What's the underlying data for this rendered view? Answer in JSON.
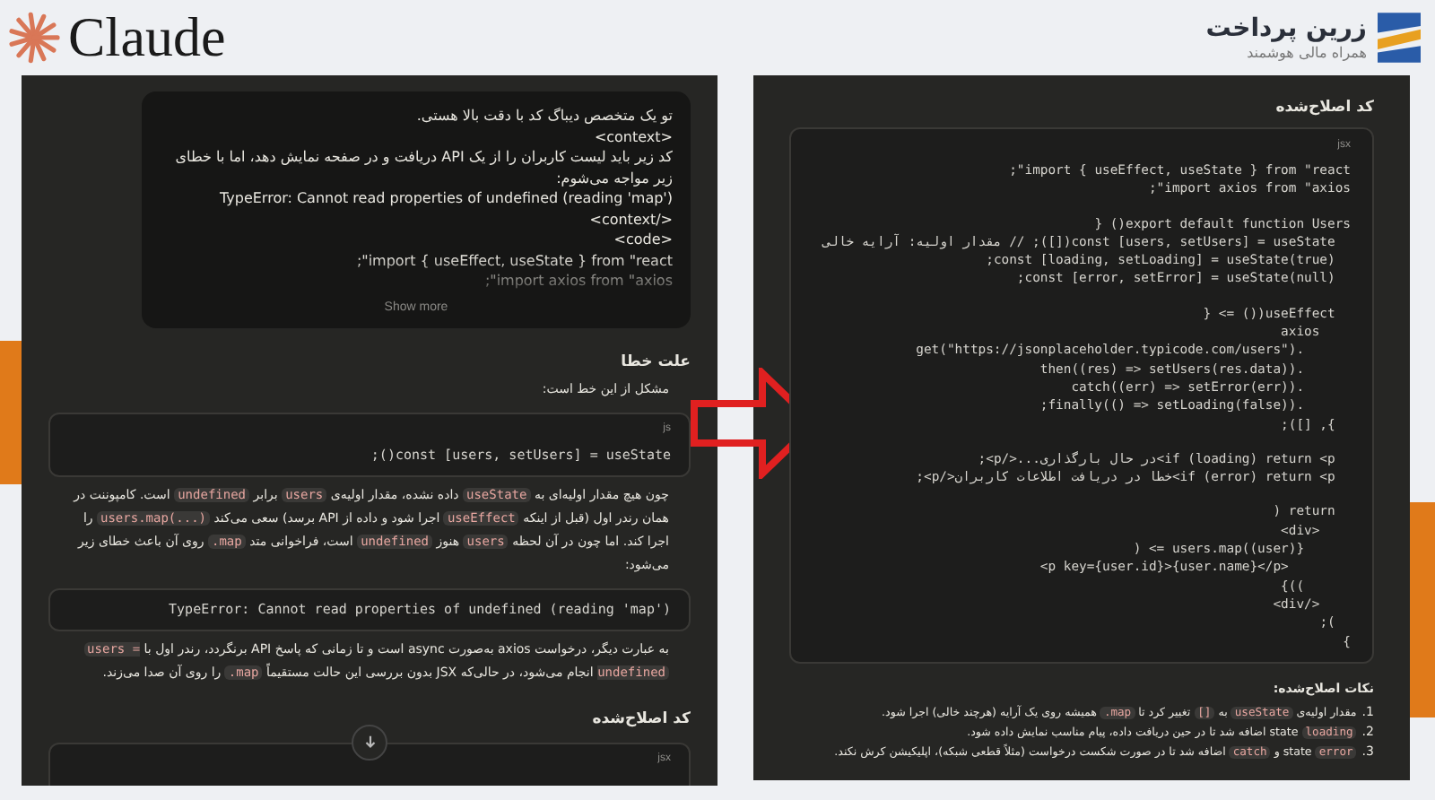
{
  "header": {
    "left_logo": "Claude",
    "right_logo": {
      "name": "زرین پرداخت",
      "tagline": "همراه مالی هوشمند"
    }
  },
  "left_panel": {
    "prompt": {
      "lines": [
        "تو یک متخصص دیباگ کد با دقت بالا هستی.",
        "<context>",
        "کد زیر باید لیست کاربران را از یک API دریافت و در صفحه نمایش دهد، اما با خطای زیر مواجه می‌شوم:",
        "TypeError: Cannot read properties of undefined (reading 'map')",
        "</context>",
        "<code>",
        "import { useEffect, useState } from \"react\";",
        "import axios from \"axios\";"
      ],
      "show_more": "Show more"
    },
    "blocks": [
      {
        "kind": "heading",
        "text": "علت خطا"
      },
      {
        "kind": "paragraph",
        "parts": [
          {
            "kind": "text",
            "text": "مشکل از این خط است:"
          }
        ]
      },
      {
        "kind": "code",
        "language": "js",
        "groups": [
          [
            "const [users, setUsers] = useState();"
          ]
        ]
      },
      {
        "kind": "paragraph",
        "parts": [
          {
            "kind": "text",
            "text": "چون هیچ مقدار اولیه‌ای به "
          },
          {
            "kind": "code",
            "text": "useState"
          },
          {
            "kind": "text",
            "text": " داده نشده، مقدار اولیه‌ی "
          },
          {
            "kind": "code",
            "text": "users"
          },
          {
            "kind": "text",
            "text": " برابر "
          },
          {
            "kind": "code",
            "text": "undefined"
          },
          {
            "kind": "text",
            "text": " است. کامپوننت در همان رندر اول (قبل از اینکه "
          },
          {
            "kind": "code",
            "text": "useEffect"
          },
          {
            "kind": "text",
            "text": " اجرا شود و داده از API برسد) سعی می‌کند "
          },
          {
            "kind": "code",
            "text": "users.map(...)"
          },
          {
            "kind": "text",
            "text": " را اجرا کند. اما چون در آن لحظه "
          },
          {
            "kind": "code",
            "text": "users"
          },
          {
            "kind": "text",
            "text": " هنوز "
          },
          {
            "kind": "code",
            "text": "undefined"
          },
          {
            "kind": "text",
            "text": " است، فراخوانی متد "
          },
          {
            "kind": "code",
            "text": ".map"
          },
          {
            "kind": "text",
            "text": " روی آن باعث خطای زیر می‌شود:"
          }
        ]
      },
      {
        "kind": "code",
        "groups": [
          [
            "TypeError: Cannot read properties of undefined (reading 'map')"
          ]
        ]
      },
      {
        "kind": "paragraph",
        "parts": [
          {
            "kind": "text",
            "text": "به عبارت دیگر، درخواست axios به‌صورت async است و تا زمانی که پاسخ API برنگردد، رندر اول با "
          },
          {
            "kind": "code",
            "text": "users = undefined"
          },
          {
            "kind": "text",
            "text": " انجام می‌شود، در حالی‌که JSX بدون بررسی این حالت مستقیماً "
          },
          {
            "kind": "code",
            "text": ".map"
          },
          {
            "kind": "text",
            "text": " را روی آن صدا می‌زند."
          }
        ]
      },
      {
        "kind": "heading",
        "text": "کد اصلاح‌شده"
      },
      {
        "kind": "code",
        "language": "jsx",
        "scroll_button": true
      }
    ]
  },
  "right_panel": {
    "heading": "کد اصلاح‌شده",
    "code": {
      "language": "jsx",
      "groups": [
        [
          "import { useEffect, useState } from \"react\";",
          "import axios from \"axios\";"
        ],
        [
          "export default function Users() {",
          "  const [users, setUsers] = useState([]); // مقدار اولیه: آرایه خالی",
          "  const [loading, setLoading] = useState(true);",
          "  const [error, setError] = useState(null);"
        ],
        [
          "  useEffect(() => {",
          "    axios",
          "      .get(\"https://jsonplaceholder.typicode.com/users\")",
          "      .then((res) => setUsers(res.data))",
          "      .catch((err) => setError(err))",
          "      .finally(() => setLoading(false));",
          "  }, []);"
        ],
        [
          "  if (loading) return <p>در حال بارگذاری...</p>;",
          "  if (error) return <p>خطا در دریافت اطلاعات کاربران</p>;"
        ],
        [
          "  return (",
          "    <div>",
          "      {users.map((user) => (",
          "        <p key={user.id}>{user.name}</p>",
          "      ))}",
          "    </div>",
          "  );",
          "}"
        ]
      ]
    },
    "notes_heading": "نکات اصلاح‌شده:",
    "notes": [
      {
        "number": "1.",
        "parts": [
          {
            "kind": "text",
            "text": "مقدار اولیه‌ی "
          },
          {
            "kind": "code",
            "text": "useState"
          },
          {
            "kind": "text",
            "text": " به "
          },
          {
            "kind": "code",
            "text": "[]"
          },
          {
            "kind": "text",
            "text": " تغییر کرد تا "
          },
          {
            "kind": "code",
            "text": ".map"
          },
          {
            "kind": "text",
            "text": " همیشه روی یک آرایه (هرچند خالی) اجرا شود."
          }
        ]
      },
      {
        "number": "2.",
        "parts": [
          {
            "kind": "code",
            "text": "loading"
          },
          {
            "kind": "text",
            "text": " state اضافه شد تا در حین دریافت داده، پیام مناسب نمایش داده شود."
          }
        ]
      },
      {
        "number": "3.",
        "parts": [
          {
            "kind": "code",
            "text": "error"
          },
          {
            "kind": "text",
            "text": " state و "
          },
          {
            "kind": "code",
            "text": "catch"
          },
          {
            "kind": "text",
            "text": " اضافه شد تا در صورت شکست درخواست (مثلاً قطعی شبکه)، اپلیکیشن کرش نکند."
          }
        ]
      }
    ]
  }
}
